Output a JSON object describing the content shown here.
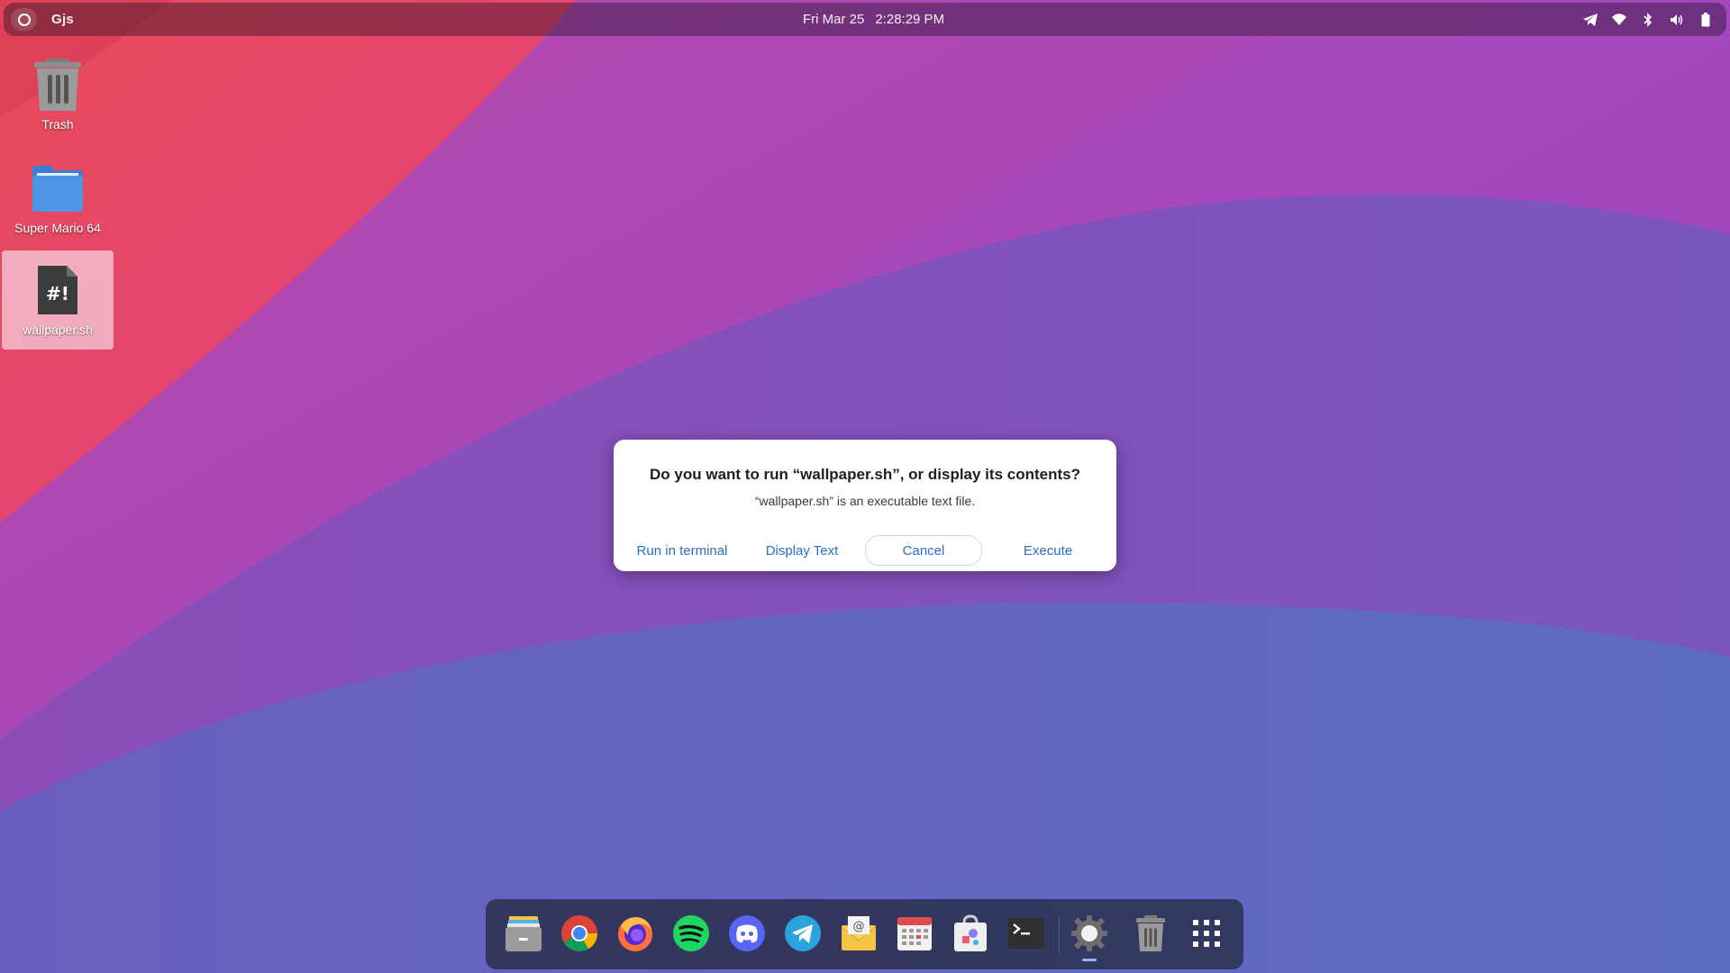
{
  "topbar": {
    "app_menu": "Gjs",
    "date": "Fri Mar 25",
    "time": "2:28:29 PM",
    "tray_icons": [
      "telegram-tray-icon",
      "wifi-icon",
      "bluetooth-icon",
      "volume-icon",
      "battery-icon"
    ]
  },
  "desktop": {
    "icons": [
      {
        "label": "Trash",
        "icon": "trash-icon"
      },
      {
        "label": "Super Mario 64",
        "icon": "folder-icon"
      },
      {
        "label": "wallpaper.sh",
        "icon": "script-file-icon",
        "selected": true
      }
    ]
  },
  "dialog": {
    "title": "Do you want to run “wallpaper.sh”, or display its contents?",
    "body": "“wallpaper.sh” is an executable text file.",
    "buttons": {
      "run_in_terminal": "Run in terminal",
      "display_text": "Display Text",
      "cancel": "Cancel",
      "execute": "Execute"
    }
  },
  "dock": {
    "items": [
      "files-icon",
      "chrome-icon",
      "firefox-icon",
      "spotify-icon",
      "discord-icon",
      "telegram-icon",
      "mail-icon",
      "calendar-icon",
      "software-store-icon",
      "terminal-icon",
      "settings-icon",
      "trash-icon",
      "app-grid-icon"
    ],
    "running": "settings-icon"
  },
  "colors": {
    "accent": "#2a6fc4",
    "wallpaper_pink": "#e8466e",
    "wallpaper_purple": "#a446b8",
    "wallpaper_blue": "#5e6cc0"
  }
}
